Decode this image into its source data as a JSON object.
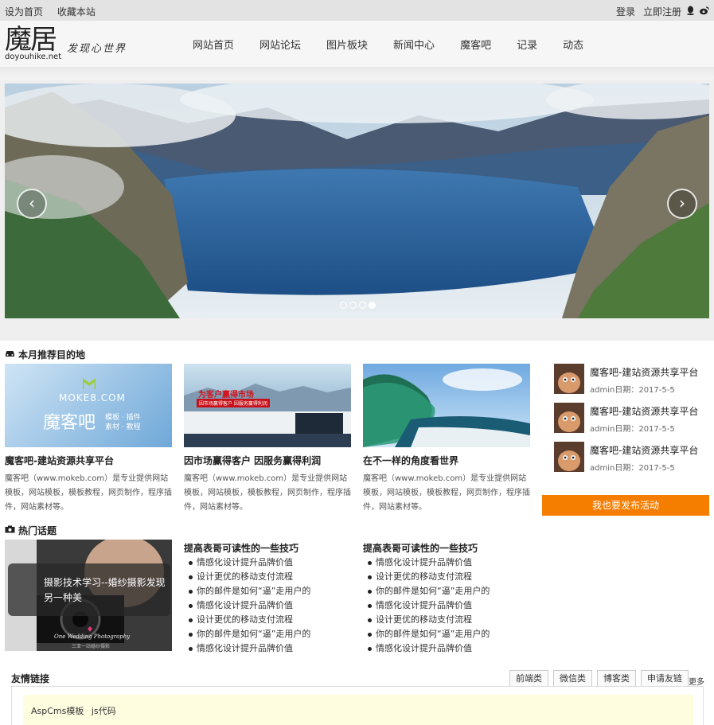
{
  "topbar": {
    "set_home": "设为首页",
    "bookmark": "收藏本站",
    "login": "登录",
    "register": "立即注册"
  },
  "header": {
    "logo_glyph": "魔居",
    "logo_domain": "doyouhike.net",
    "slogan": "发现心世界"
  },
  "nav": {
    "items": [
      "网站首页",
      "网站论坛",
      "图片板块",
      "新闻中心",
      "魔客吧",
      "记录",
      "动态"
    ]
  },
  "banner": {
    "prev_icon": "chevron-left-icon",
    "next_icon": "chevron-right-icon",
    "slides": 4,
    "active_slide": 4
  },
  "recommend": {
    "title": "本月推荐目的地",
    "cards": [
      {
        "title": "魔客吧-建站资源共享平台",
        "desc": "魔客吧（www.mokeb.com）是专业提供网站模板，网站模板，模板教程，网页制作，程序插件，网站素材等。",
        "img_text_1": "MOKE8.COM",
        "img_text_2": "魔客吧",
        "img_text_3": "模板 · 插件",
        "img_text_4": "素材 · 教程"
      },
      {
        "title": "因市场赢得客户 因服务赢得利润",
        "desc": "魔客吧（www.mokeb.com）是专业提供网站模板，网站模板，模板教程，网页制作，程序插件，网站素材等。",
        "img_text_1": "为客户赢得市场",
        "img_text_2": "因市场赢得客户 因服务赢得利润"
      },
      {
        "title": "在不一样的角度看世界",
        "desc": "魔客吧（www.mokeb.com）是专业提供网站模板，网站模板，模板教程，网页制作，程序插件，网站素材等。"
      }
    ]
  },
  "side": {
    "items": [
      {
        "title": "魔客吧-建站资源共享平台",
        "meta": "admin日期：2017-5-5"
      },
      {
        "title": "魔客吧-建站资源共享平台",
        "meta": "admin日期：2017-5-5"
      },
      {
        "title": "魔客吧-建站资源共享平台",
        "meta": "admin日期：2017-5-5"
      }
    ],
    "publish_label": "我也要发布活动"
  },
  "hot": {
    "title": "热门话题",
    "feature_caption": "摄影技术学习--婚纱摄影发现另一种美",
    "feature_brand": "One Wedding Photography",
    "feature_brand_sub": "三亚一站婚纱摄影",
    "columns": [
      {
        "title": "提高表哥可读性的一些技巧",
        "items": [
          "情感化设计提升品牌价值",
          "设计更优的移动支付流程",
          "你的邮件是如何“逼”走用户的",
          "情感化设计提升品牌价值",
          "设计更优的移动支付流程",
          "你的邮件是如何“逼”走用户的",
          "情感化设计提升品牌价值"
        ]
      },
      {
        "title": "提高表哥可读性的一些技巧",
        "items": [
          "情感化设计提升品牌价值",
          "设计更优的移动支付流程",
          "你的邮件是如何“逼”走用户的",
          "情感化设计提升品牌价值",
          "设计更优的移动支付流程",
          "你的邮件是如何“逼”走用户的",
          "情感化设计提升品牌价值"
        ]
      }
    ]
  },
  "links": {
    "title": "友情链接",
    "tabs": [
      "前端类",
      "微信类",
      "博客类",
      "申请友链"
    ],
    "more": "更多",
    "entries": [
      "AspCms模板",
      "js代码"
    ]
  }
}
